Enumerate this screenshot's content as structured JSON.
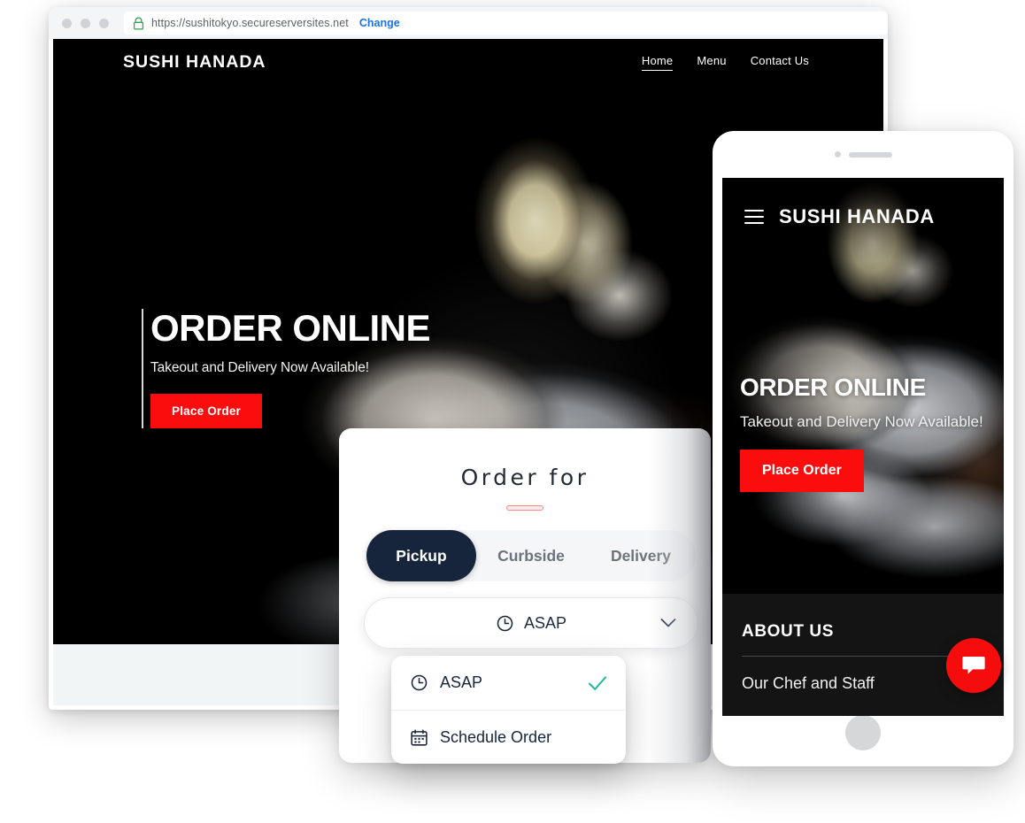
{
  "browser": {
    "url": "https://sushitokyo.secureserversites.net",
    "change_label": "Change",
    "lock_icon": "lock-icon"
  },
  "site": {
    "brand": "SUSHI HANADA",
    "nav": [
      {
        "label": "Home",
        "active": true
      },
      {
        "label": "Menu",
        "active": false
      },
      {
        "label": "Contact Us",
        "active": false
      }
    ],
    "hero": {
      "title": "ORDER ONLINE",
      "subtitle": "Takeout and Delivery Now Available!",
      "cta_label": "Place Order"
    }
  },
  "order_card": {
    "heading": "Order for",
    "segments": [
      {
        "label": "Pickup",
        "active": true
      },
      {
        "label": "Curbside",
        "active": false
      },
      {
        "label": "Delivery",
        "active": false
      }
    ],
    "when_selected": "ASAP",
    "when_icon": "clock-icon",
    "chevron_icon": "chevron-down-icon",
    "dropdown": [
      {
        "label": "ASAP",
        "icon": "clock-icon",
        "selected": true,
        "check_icon": "check-icon"
      },
      {
        "label": "Schedule Order",
        "icon": "calendar-icon",
        "selected": false
      }
    ]
  },
  "phone": {
    "brand": "SUSHI HANADA",
    "menu_icon": "hamburger-menu-icon",
    "hero": {
      "title": "ORDER ONLINE",
      "subtitle": "Takeout and Delivery Now Available!",
      "cta_label": "Place Order"
    },
    "about": {
      "title": "ABOUT US",
      "item": "Our Chef and Staff"
    },
    "home_button": "home-button"
  },
  "chat": {
    "icon": "chat-bubble-icon"
  },
  "colors": {
    "accent_red": "#fc0d0d",
    "navy": "#16253c",
    "check_teal": "#2bb79b",
    "link_blue": "#1a73e8",
    "lock_green": "#2aa84a"
  }
}
